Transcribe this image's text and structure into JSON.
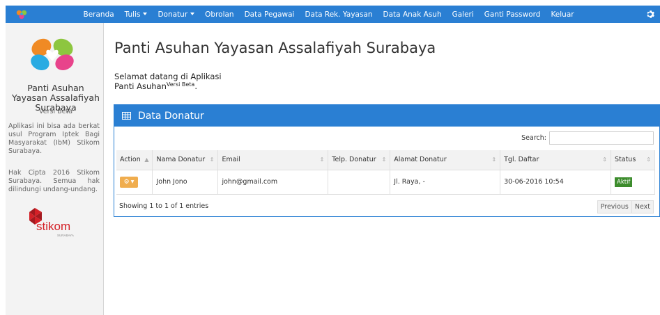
{
  "nav": {
    "items": [
      {
        "label": "Beranda",
        "dropdown": false
      },
      {
        "label": "Tulis",
        "dropdown": true
      },
      {
        "label": "Donatur",
        "dropdown": true
      },
      {
        "label": "Obrolan",
        "dropdown": false
      },
      {
        "label": "Data Pegawai",
        "dropdown": false
      },
      {
        "label": "Data Rek. Yayasan",
        "dropdown": false
      },
      {
        "label": "Data Anak Asuh",
        "dropdown": false
      },
      {
        "label": "Galeri",
        "dropdown": false
      },
      {
        "label": "Ganti Password",
        "dropdown": false
      },
      {
        "label": "Keluar",
        "dropdown": false
      }
    ],
    "settings_icon": "gear-icon",
    "bg_color": "#2a7fd3"
  },
  "sidebar": {
    "title": "Panti Asuhan Yayasan Assalafiyah Surabaya",
    "version": "Versi Beta",
    "description": "Aplikasi ini bisa ada berkat usul Program Iptek Bagi Masyarakat (IbM) Stikom Surabaya.",
    "copyright": "Hak Cipta 2016 Stikom Surabaya. Semua hak dilindungi undang-undang.",
    "partner_logo_text": "stikom",
    "partner_logo_subtext": "SURABAYA"
  },
  "main": {
    "title": "Panti Asuhan Yayasan Assalafiyah Surabaya",
    "welcome_line1": "Selamat datang di Aplikasi",
    "welcome_line2": "Panti Asuhan",
    "welcome_sup": "Versi Beta",
    "welcome_end": "."
  },
  "panel": {
    "title": "Data Donatur",
    "search_label": "Search:",
    "columns": [
      "Action",
      "Nama Donatur",
      "Email",
      "Telp. Donatur",
      "Alamat Donatur",
      "Tgl. Daftar",
      "Status"
    ],
    "rows": [
      {
        "nama": "John Jono",
        "email": "john@gmail.com",
        "telp": "",
        "alamat": "Jl. Raya, -",
        "tgl": "30-06-2016 10:54",
        "status": "Aktif"
      }
    ],
    "entries_info": "Showing 1 to 1 of 1 entries",
    "prev_label": "Previous",
    "next_label": "Next",
    "status_color": "#3c8c2c",
    "action_color": "#f0ad4e"
  }
}
